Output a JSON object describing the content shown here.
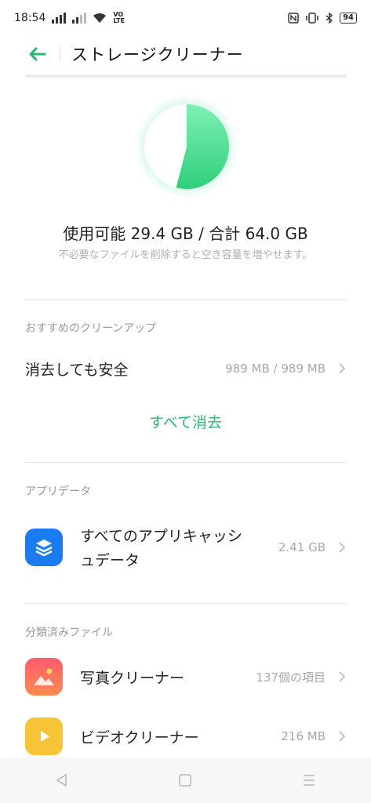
{
  "status": {
    "time": "18:54",
    "net_label": "VO LTE",
    "battery": "94"
  },
  "header": {
    "title": "ストレージクリーナー"
  },
  "storage": {
    "available_label": "使用可能",
    "available_value": "29.4 GB",
    "separator": "/",
    "total_label": "合計",
    "total_value": "64.0 GB",
    "hint": "不必要なファイルを削除すると空き容量を増やせます。",
    "used_fraction": 0.54,
    "accent_color": "#3ddc84"
  },
  "recommended": {
    "section_label": "おすすめのクリーンアップ",
    "safe_delete_label": "消去しても安全",
    "safe_delete_value": "989 MB / 989 MB",
    "clear_all_label": "すべて消去"
  },
  "app_data": {
    "section_label": "アプリデータ",
    "cache_line1": "すべてのアプリキャッシ",
    "cache_line2": "ュデータ",
    "cache_value": "2.41 GB"
  },
  "categorized": {
    "section_label": "分類済みファイル",
    "items": [
      {
        "label": "写真クリーナー",
        "value": "137個の項目",
        "icon": "photo-icon"
      },
      {
        "label": "ビデオクリーナー",
        "value": "216 MB",
        "icon": "video-icon"
      }
    ]
  }
}
